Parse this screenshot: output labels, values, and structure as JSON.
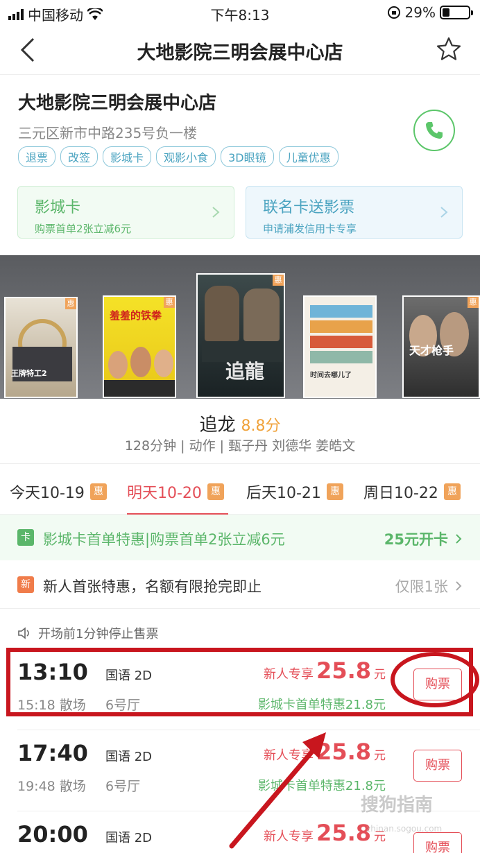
{
  "status_bar": {
    "carrier": "中国移动",
    "time": "下午8:13",
    "battery": "29%",
    "battery_level": 0.29
  },
  "nav": {
    "title": "大地影院三明会展中心店"
  },
  "cinema": {
    "name": "大地影院三明会展中心店",
    "address": "三元区新市中路235号负一楼",
    "tags": [
      "退票",
      "改签",
      "影城卡",
      "观影小食",
      "3D眼镜",
      "儿童优惠"
    ]
  },
  "promos": [
    {
      "title": "影城卡",
      "subtitle": "购票首单2张立减6元"
    },
    {
      "title": "联名卡送影票",
      "subtitle": "申请浦发信用卡专享"
    }
  ],
  "posters": [
    {
      "title": "王牌特工2",
      "badge": "惠"
    },
    {
      "title": "羞羞的铁拳",
      "badge": "惠"
    },
    {
      "title": "追龍",
      "badge": "惠"
    },
    {
      "title": "时间去哪儿了",
      "badge": ""
    },
    {
      "title": "天才枪手",
      "badge": "惠"
    }
  ],
  "movie": {
    "title": "追龙",
    "score": "8.8分",
    "meta": "128分钟 | 动作 | 甄子丹 刘德华 姜皓文"
  },
  "date_tabs": [
    {
      "label": "今天10-19",
      "badge": "惠"
    },
    {
      "label": "明天10-20",
      "badge": "惠"
    },
    {
      "label": "后天10-21",
      "badge": "惠"
    },
    {
      "label": "周日10-22",
      "badge": "惠"
    }
  ],
  "card_bar": {
    "icon": "卡",
    "text": "影城卡首单特惠|购票首单2张立减6元",
    "action": "25元开卡"
  },
  "new_bar": {
    "icon": "新",
    "text": "新人首张特惠，名额有限抢完即止",
    "action": "仅限1张"
  },
  "notice": "开场前1分钟停止售票",
  "showtimes": [
    {
      "time": "13:10",
      "end": "15:18 散场",
      "lang": "国语 2D",
      "hall": "6号厅",
      "price_label": "新人专享",
      "price": "25.8",
      "unit": "元",
      "card_price": "影城卡首单特惠21.8元",
      "button": "购票"
    },
    {
      "time": "17:40",
      "end": "19:48 散场",
      "lang": "国语 2D",
      "hall": "6号厅",
      "price_label": "新人专享",
      "price": "25.8",
      "unit": "元",
      "card_price": "影城卡首单特惠21.8元",
      "button": "购票"
    },
    {
      "time": "20:00",
      "end": "",
      "lang": "国语 2D",
      "hall": "",
      "price_label": "新人专享",
      "price": "25.8",
      "unit": "元",
      "card_price": "",
      "button": "购票"
    }
  ],
  "watermark": {
    "text": "搜狗指南",
    "sub": "zhinan.sogou.com"
  },
  "colors": {
    "accent_red": "#e44e57",
    "green": "#5bb66a",
    "blue": "#4aa3c0",
    "orange_badge": "#f0a35a",
    "annotation_red": "#c8161e"
  }
}
